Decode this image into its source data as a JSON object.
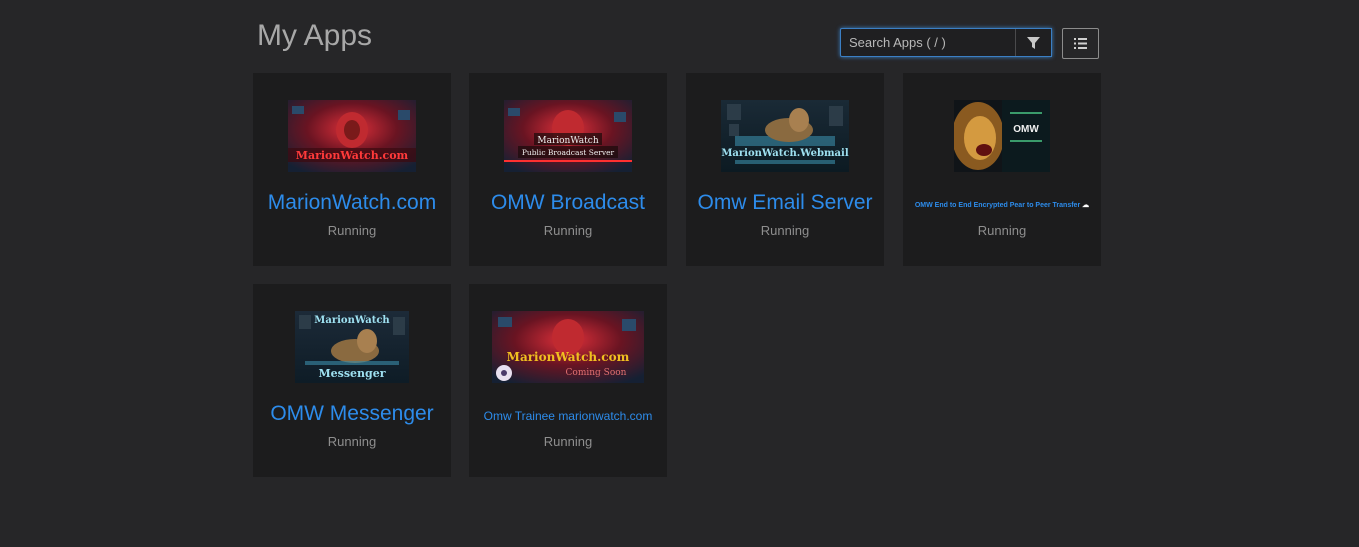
{
  "header": {
    "title": "My Apps",
    "search_placeholder": "Search Apps ( / )",
    "filter_icon": "filter-icon",
    "view_icon": "list-view-icon"
  },
  "apps": [
    {
      "title": "MarionWatch.com",
      "status": "Running",
      "thumb_text": "MarionWatch.com",
      "thumb_subtext": ""
    },
    {
      "title": "OMW Broadcast",
      "status": "Running",
      "thumb_text": "MarionWatch",
      "thumb_subtext": "Public Broadcast Server"
    },
    {
      "title": "Omw Email Server",
      "status": "Running",
      "thumb_text": "MarionWatch.Webmail",
      "thumb_subtext": ""
    },
    {
      "title": "OMW End to End Encrypted Pear to Peer Transfer",
      "status": "Running",
      "thumb_text": "OMW",
      "thumb_subtext": ""
    },
    {
      "title": "OMW Messenger",
      "status": "Running",
      "thumb_text": "MarionWatch",
      "thumb_subtext": "Messenger"
    },
    {
      "title": "Omw Trainee marionwatch.com",
      "status": "Running",
      "thumb_text": "MarionWatch.com",
      "thumb_subtext": "Coming Soon"
    }
  ],
  "colors": {
    "background": "#262628",
    "card": "#1c1c1d",
    "link": "#2d8ceb",
    "status": "#8e8e8e",
    "focus": "#3b7fc4"
  }
}
